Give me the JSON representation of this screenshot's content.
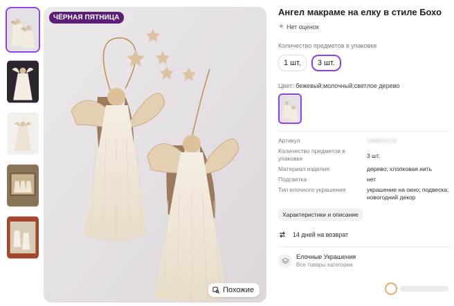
{
  "thumbnails": [
    {
      "name": "thumb-1",
      "active": true
    },
    {
      "name": "thumb-2",
      "active": false
    },
    {
      "name": "thumb-3",
      "active": false
    },
    {
      "name": "thumb-4",
      "active": false
    },
    {
      "name": "thumb-5",
      "active": false
    }
  ],
  "main_image": {
    "badge": "ЧЁРНАЯ ПЯТНИЦА",
    "similar_label": "Похожие"
  },
  "product": {
    "title": "Ангел макраме на елку в стиле Бохо",
    "rating_text": "Нет оценок",
    "qty_label": "Количество предметов в упаковке",
    "qty_options": [
      "1 шт.",
      "3 шт."
    ],
    "qty_selected": "3 шт.",
    "color_label": "Цвет:",
    "color_value": "бежевый;молочный;светлое дерево"
  },
  "specs": [
    {
      "key": "Артикул",
      "value": "184902218"
    },
    {
      "key": "Количество предметов в упаковке",
      "value": "3 шт."
    },
    {
      "key": "Материал изделия",
      "value": "дерево; хлопковая нить"
    },
    {
      "key": "Подсветка",
      "value": "нет"
    },
    {
      "key": "Тип елочного украшения",
      "value": "украшение на окно; подвеска; новогодний декор"
    }
  ],
  "characteristics_button": "Характеристики и описание",
  "returns": "14 дней на возврат",
  "category": {
    "name": "Елочные Украшения",
    "sub": "Все товары категории"
  },
  "colors": {
    "accent": "#8a3ff2",
    "badge_bg": "#5b1f7a"
  }
}
